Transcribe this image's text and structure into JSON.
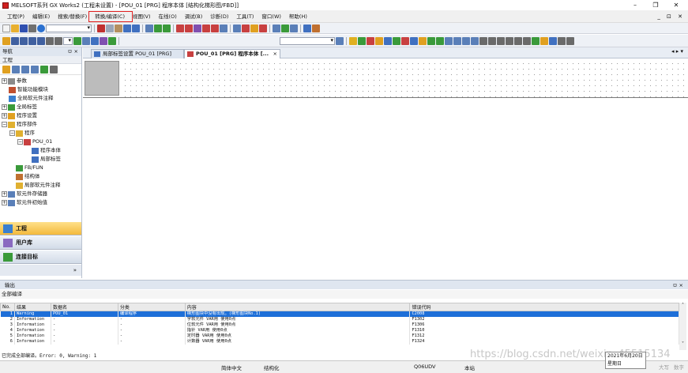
{
  "window": {
    "title": "MELSOFT系列 GX Works2 (工程未设置) - [POU_01 [PRG] 程序本体 [结构化梯形图/FBD]]",
    "min": "–",
    "max": "❐",
    "close": "✕",
    "mdi_controls": "_ ⊡ ✕"
  },
  "menu": {
    "items": [
      "工程(P)",
      "编辑(E)",
      "搜索/替换(F)",
      "转换/编译(C)",
      "视图(V)",
      "在线(O)",
      "调试(B)",
      "诊断(D)",
      "工具(T)",
      "窗口(W)",
      "帮助(H)"
    ]
  },
  "nav": {
    "title": "导航",
    "pin": "ㅁ ×",
    "section": "工程",
    "tree": [
      "参数",
      "智能功能模块",
      "全局软元件注释",
      "全局标签",
      "程序设置",
      "程序部件",
      "程序",
      "POU_01",
      "程序本体",
      "局部标签",
      "FB/FUN",
      "结构体",
      "局部软元件注释",
      "软元件存储器",
      "软元件初始值"
    ],
    "buttons": [
      "工程",
      "用户库",
      "连接目标"
    ]
  },
  "tabs": [
    "局部标签设置 POU_01 [PRG]",
    "POU_01 [PRG] 程序本体 [...",
    "×"
  ],
  "tab_scroll": "◂ ▸ ▾",
  "output": {
    "title": "输出",
    "pin": "ㅁ ×",
    "subtitle": "全部编译",
    "columns": [
      "No.",
      "结果",
      "数据名",
      "分类",
      "内容",
      "错误代码"
    ],
    "rows": [
      [
        "1",
        "Warning",
        "POU_01",
        "编译程序",
        "梯形图块中没有出现。(梯形图块No.1)",
        "C2008"
      ],
      [
        "2",
        "Information",
        "-",
        "-",
        "字软元件 VAR用 使用0点",
        "F1302"
      ],
      [
        "3",
        "Information",
        "-",
        "-",
        "位软元件 VAR用 使用0点",
        "F1306"
      ],
      [
        "4",
        "Information",
        "-",
        "-",
        "指针 VAR用 使用0点",
        "F1310"
      ],
      [
        "5",
        "Information",
        "-",
        "-",
        "定时器 VAR用 使用0点",
        "F1312"
      ],
      [
        "6",
        "Information",
        "-",
        "-",
        "计数器 VAR用 使用0点",
        "F1324"
      ]
    ],
    "summary": "已完成全部编译。Error: 0, Warning: 1"
  },
  "status": {
    "lang": "简体中文",
    "mode": "结构化",
    "cpu": "Q06UDV",
    "station": "本站"
  },
  "clock": {
    "date": "2021年6月20日",
    "day": "星期日"
  },
  "ime": {
    "mode": "大写",
    "num": "数字"
  },
  "watermark": "https://blog.csdn.net/weixin_45515134"
}
